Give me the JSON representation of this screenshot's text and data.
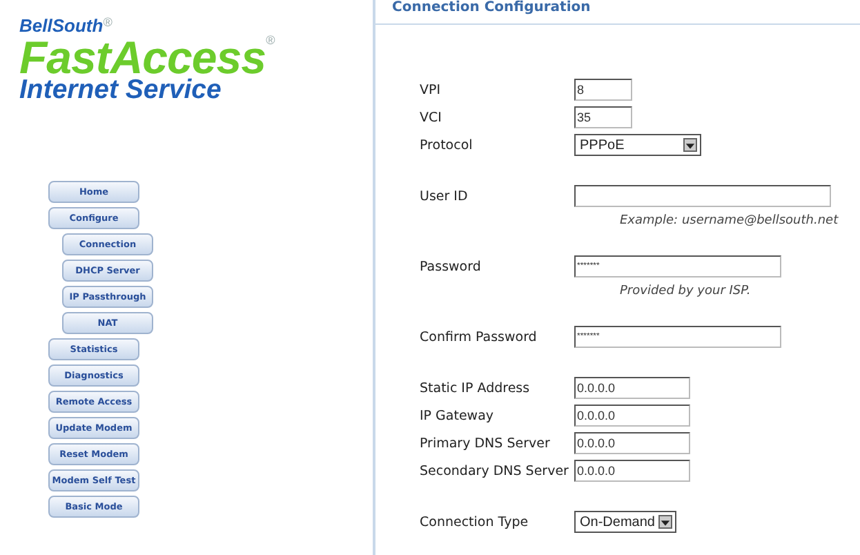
{
  "logo": {
    "brand": "BellSouth",
    "brand_mark": "®",
    "product": "FastAccess",
    "product_mark": "®",
    "tagline": "Internet Service"
  },
  "nav": [
    {
      "label": "Home",
      "kind": "main"
    },
    {
      "label": "Configure",
      "kind": "main"
    },
    {
      "label": "Connection",
      "kind": "sub"
    },
    {
      "label": "DHCP Server",
      "kind": "sub"
    },
    {
      "label": "IP Passthrough",
      "kind": "sub"
    },
    {
      "label": "NAT",
      "kind": "sub"
    },
    {
      "label": "Statistics",
      "kind": "main"
    },
    {
      "label": "Diagnostics",
      "kind": "main"
    },
    {
      "label": "Remote Access",
      "kind": "main"
    },
    {
      "label": "Update Modem",
      "kind": "main"
    },
    {
      "label": "Reset Modem",
      "kind": "main"
    },
    {
      "label": "Modem Self Test",
      "kind": "main"
    },
    {
      "label": "Basic Mode",
      "kind": "main"
    }
  ],
  "panel": {
    "title": "Connection Configuration",
    "groups": [
      {
        "fields": [
          {
            "label": "VPI",
            "kind": "short",
            "value": "8"
          },
          {
            "label": "VCI",
            "kind": "short",
            "value": "35"
          },
          {
            "label": "Protocol",
            "kind": "select",
            "value": "PPPoE"
          }
        ]
      },
      {
        "fields": [
          {
            "label": "User ID",
            "kind": "long",
            "hint": "Example:   username@bellsouth.net"
          }
        ]
      },
      {
        "fields": [
          {
            "label": "Password",
            "kind": "password",
            "value": "*******",
            "hint": "Provided by your ISP."
          }
        ]
      },
      {
        "fields": [
          {
            "label": "Confirm Password",
            "kind": "password",
            "value": "*******"
          }
        ]
      },
      {
        "fields": [
          {
            "label": "Static IP Address",
            "kind": "ip",
            "value": "0.0.0.0"
          },
          {
            "label": "IP Gateway",
            "kind": "ip",
            "value": "0.0.0.0"
          },
          {
            "label": "Primary DNS Server",
            "kind": "ip",
            "value": "0.0.0.0"
          },
          {
            "label": "Secondary DNS Server",
            "kind": "ip",
            "value": "0.0.0.0"
          }
        ]
      },
      {
        "fields": [
          {
            "label": "Connection Type",
            "kind": "select-small",
            "value": "On-Demand"
          }
        ]
      }
    ]
  }
}
